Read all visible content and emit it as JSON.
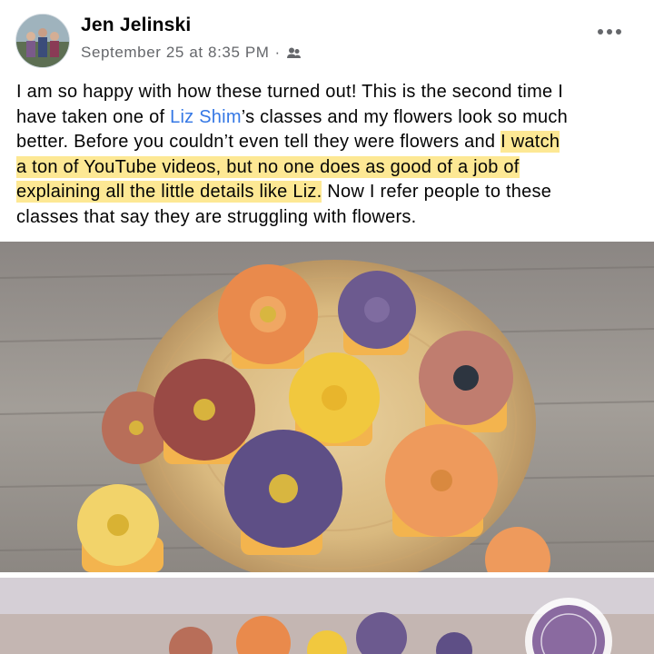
{
  "post": {
    "author": "Jen Jelinski",
    "timestamp": "September 25 at 8:35 PM",
    "separator": "·",
    "audience_icon": "friends-icon",
    "more_icon": "more-options-icon",
    "text": {
      "l1": "I am so happy with how these turned out! This is the second time I",
      "l2_a": "have taken one of ",
      "l2_link": "Liz Shim",
      "l2_b": "’s classes and my flowers look so much",
      "l3_a": "better. Before you couldn’t even tell they were flowers and ",
      "l3_hl": "I watch",
      "l4_hl": "a ton of YouTube videos, but no one does as good of a job of",
      "l5_hl": "explaining all the little details like Liz.",
      "l5_b": " Now I refer people to these",
      "l6": "classes that say they are struggling with flowers."
    },
    "photos": [
      {
        "name": "cupcakes-photo-1",
        "subject": "buttercream flower cupcakes on wooden slab"
      },
      {
        "name": "cupcakes-photo-2",
        "subject": "buttercream flower cupcakes with logo watermark"
      }
    ],
    "colors": {
      "link": "#3578e5",
      "highlight": "#fde894",
      "meta": "#65676b"
    }
  }
}
